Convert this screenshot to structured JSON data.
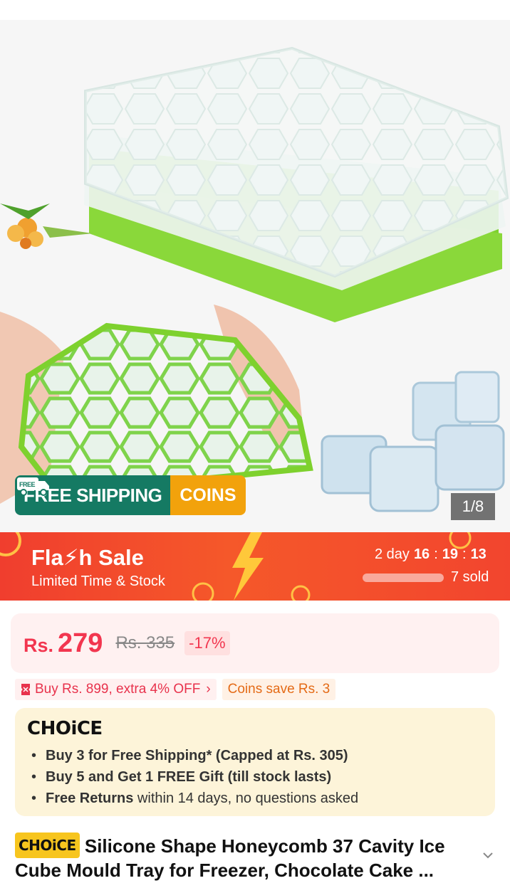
{
  "gallery": {
    "counter": "1/8",
    "shipping_badge": {
      "icon_label": "FREE",
      "free_shipping": "FREE SHIPPING",
      "coins": "COINS"
    }
  },
  "flash_sale": {
    "title": "Fla⚡h Sale",
    "subtitle": "Limited Time & Stock",
    "timer": {
      "days": "2 day",
      "hours": "16",
      "minutes": "19",
      "seconds": "13",
      "sep": ":"
    },
    "sold": "7 sold"
  },
  "price": {
    "currency": "Rs.",
    "current": "279",
    "original": "Rs. 335",
    "discount": "-17%"
  },
  "promos": {
    "bundle": "Buy Rs. 899, extra 4% OFF",
    "coins": "Coins save Rs. 3"
  },
  "choice": {
    "logo": "CHOiCE",
    "benefits": [
      {
        "bold": "Buy 3 for  Free Shipping* (Capped at Rs. 305)",
        "rest": ""
      },
      {
        "bold": "Buy 5 and Get 1 FREE Gift (till stock lasts)",
        "rest": ""
      },
      {
        "bold": "Free Returns",
        "rest": " within 14 days, no questions asked"
      }
    ]
  },
  "product": {
    "choice_tag": "CHOiCE",
    "title": "Silicone Shape Honeycomb 37 Cavity Ice Cube Mould Tray for Freezer, Chocolate Cake ..."
  },
  "colors": {
    "price_red": "#f2364f",
    "shipping_green": "#157a63",
    "coins_orange": "#f2a20c",
    "flash_red": "#f03e2e",
    "choice_yellow": "#f7c51e"
  }
}
